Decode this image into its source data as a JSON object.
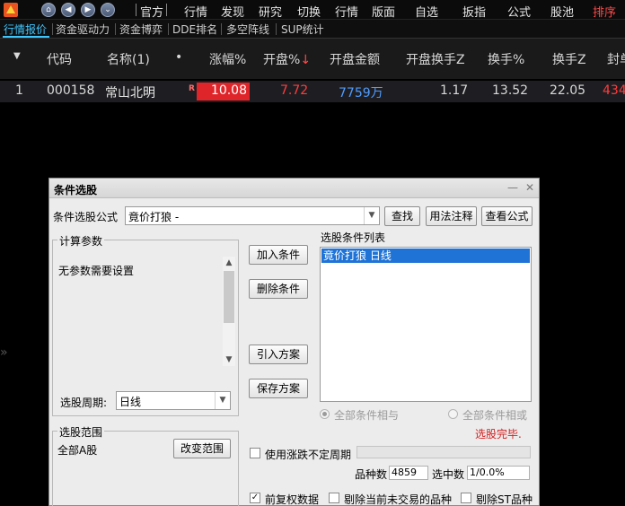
{
  "menu": {
    "items": [
      "官方",
      "行情",
      "发现",
      "研究",
      "切换",
      "行情",
      "版面",
      "自选",
      "扳指",
      "公式",
      "股池",
      "排序"
    ],
    "accent_color": "#ff4a4a"
  },
  "tabs": [
    "行情报价",
    "资金驱动力",
    "资金博弈",
    "DDE排名",
    "多空阵线",
    "SUP统计"
  ],
  "table": {
    "columns": [
      "代码",
      "名称(1)",
      "•",
      "涨幅%",
      "开盘%",
      "开盘金额",
      "开盘换手Z",
      "换手%",
      "换手Z",
      "封单"
    ],
    "sort_arrow": "↓",
    "row": {
      "index": "1",
      "code": "000158",
      "name": "常山北明",
      "badge": "R",
      "change_pct": "10.08",
      "open_pct": "7.72",
      "open_amount": "7759万",
      "open_turnover_z": "1.17",
      "turnover_pct": "13.52",
      "turnover_z": "22.05",
      "seal": "434"
    }
  },
  "dialog": {
    "title": "条件选股",
    "formula_label": "条件选股公式",
    "formula_value": "竟价打狼      -",
    "find_button": "查找",
    "usage_button": "用法注释",
    "view_formula_button": "查看公式",
    "params_group": "计算参数",
    "params_text": "无参数需要设置",
    "period_label": "选股周期:",
    "period_value": "日线",
    "add_condition": "加入条件",
    "delete_condition": "删除条件",
    "import_plan": "引入方案",
    "save_plan": "保存方案",
    "cond_list_label": "选股条件列表",
    "cond_item": "竟价打狼  日线",
    "radio_and": "全部条件相与",
    "radio_or": "全部条件相或",
    "status_text": "选股完毕.",
    "range_group": "选股范围",
    "range_value": "全部A股",
    "change_range": "改变范围",
    "use_unfixed_period": "使用涨跌不定周期",
    "total_label": "品种数",
    "total_value": "4859",
    "selected_label": "选中数",
    "selected_value": "1/0.0%",
    "check_forward_adj": "前复权数据",
    "check_exclude_untraded": "剔除当前未交易的品种",
    "check_exclude_st": "剔除ST品种"
  }
}
